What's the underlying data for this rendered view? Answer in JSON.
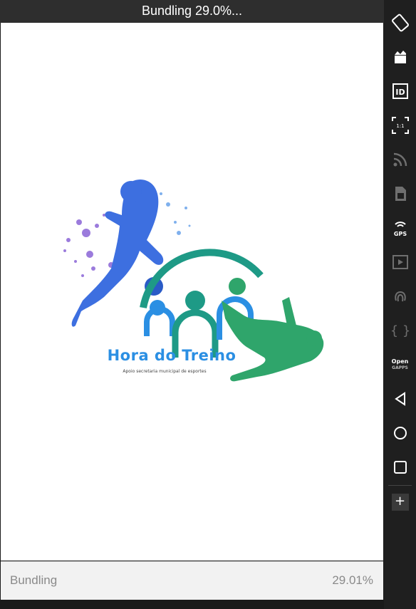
{
  "top_bar": {
    "title": "Bundling 29.0%..."
  },
  "logo": {
    "title": "Hora do Treino",
    "subtitle": "Apoio secretaria municipal de esportes"
  },
  "bundle_bar": {
    "label": "Bundling",
    "percent": "29.01%",
    "progress": 0.2901
  },
  "side_toolbar": {
    "items": [
      {
        "icon": "rotate-icon"
      },
      {
        "icon": "screen-record-icon"
      },
      {
        "icon": "id-icon",
        "text": "ID"
      },
      {
        "icon": "pixel-perfect-icon",
        "text": "1:1"
      },
      {
        "icon": "wifi-icon"
      },
      {
        "icon": "sim-card-icon"
      },
      {
        "icon": "gps-icon",
        "text": "GPS"
      },
      {
        "icon": "media-icon"
      },
      {
        "icon": "fingerprint-icon"
      },
      {
        "icon": "code-braces-icon",
        "text": "{ }"
      },
      {
        "icon": "opengapps-icon",
        "text": "Open",
        "text2": "GAPPS"
      },
      {
        "icon": "back-icon"
      },
      {
        "icon": "home-icon"
      },
      {
        "icon": "recents-icon"
      },
      {
        "icon": "plus-icon",
        "text": "+"
      }
    ]
  },
  "colors": {
    "logo_blue": "#2b8fe3",
    "logo_teal": "#1e9a86",
    "logo_green": "#2fa56b",
    "splash_purple": "#7a4fd1"
  }
}
